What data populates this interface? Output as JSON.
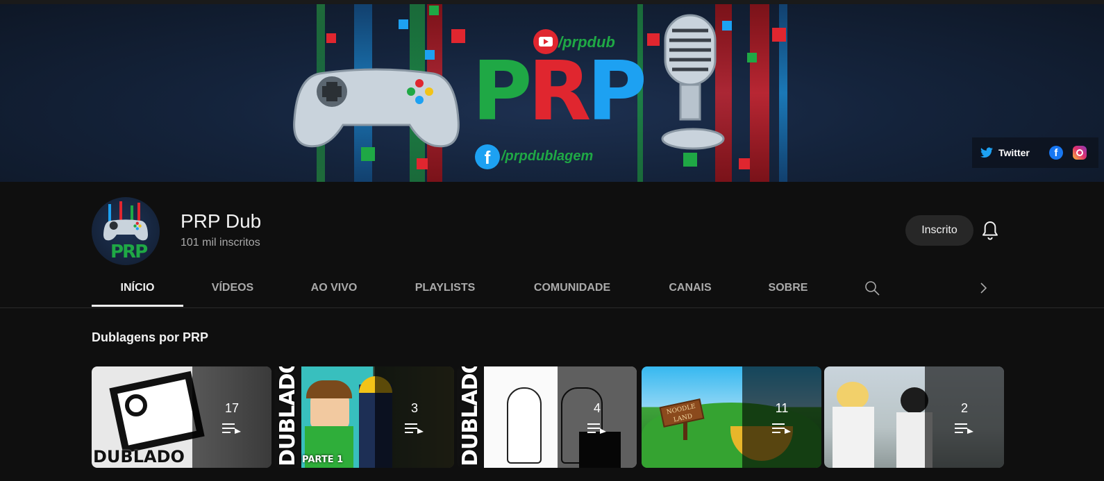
{
  "banner": {
    "youtube_handle": "/prpdub",
    "facebook_handle": "/prpdublagem",
    "logo_text": "PRP",
    "social_twitter": "Twitter",
    "colors": {
      "green": "#1fa845",
      "red": "#e0262f",
      "blue": "#1da1f2",
      "navy": "#14233b"
    }
  },
  "channel": {
    "name": "PRP Dub",
    "subscribers": "101 mil inscritos",
    "avatar_text": "PRP",
    "subscribe_label": "Inscrito"
  },
  "tabs": [
    {
      "label": "INÍCIO",
      "active": true
    },
    {
      "label": "VÍDEOS"
    },
    {
      "label": "AO VIVO"
    },
    {
      "label": "PLAYLISTS"
    },
    {
      "label": "COMUNIDADE"
    },
    {
      "label": "CANAIS"
    },
    {
      "label": "SOBRE"
    }
  ],
  "shelf": {
    "title": "Dublagens por PRP",
    "playlists": [
      {
        "count": "17",
        "thumb_text": "DUBLADO"
      },
      {
        "count": "3",
        "thumb_text": "DUBLADO",
        "sub_text": "PARTE 1"
      },
      {
        "count": "4",
        "thumb_text": "DUBLADO"
      },
      {
        "count": "11",
        "thumb_text": "NOODLE LAND"
      },
      {
        "count": "2"
      }
    ]
  }
}
